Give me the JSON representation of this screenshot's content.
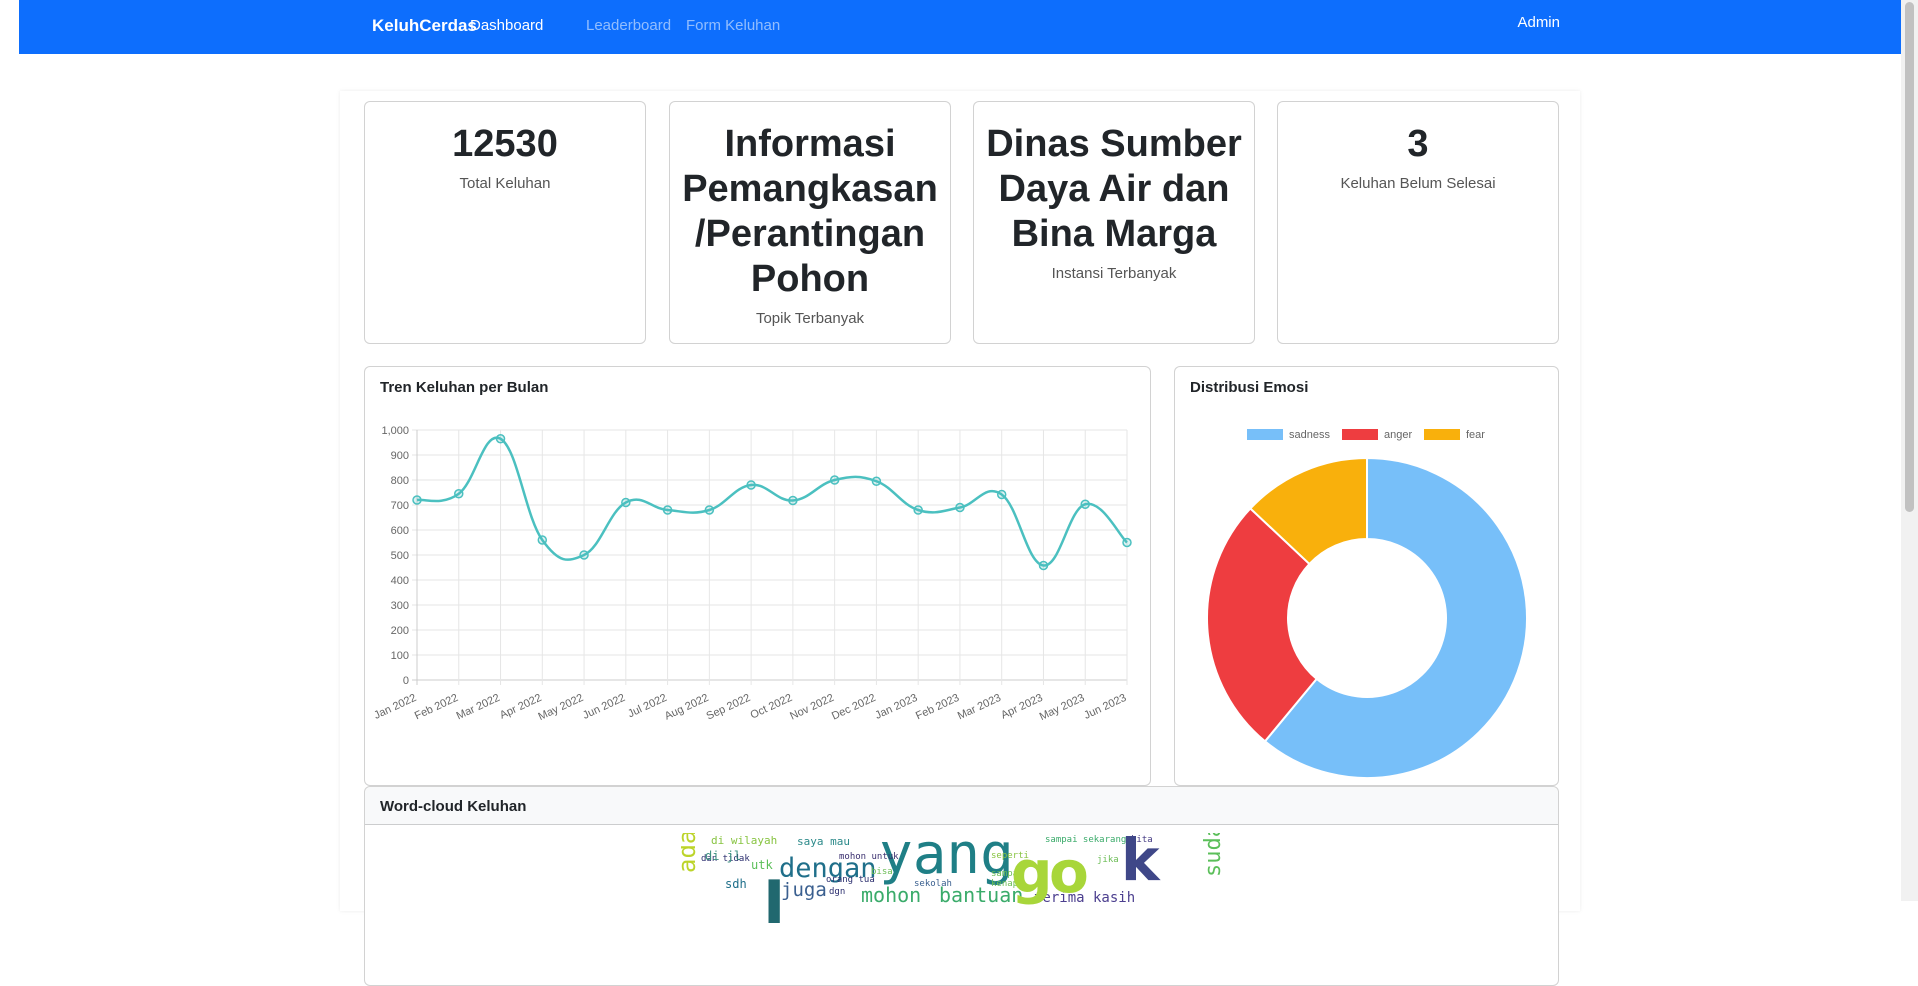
{
  "navbar": {
    "brand": "KeluhCerdas",
    "links": [
      "Dashboard",
      "Leaderboard",
      "Form Keluhan"
    ],
    "active_link": "Dashboard",
    "user": "Admin",
    "color": "#0d6efd"
  },
  "stats": [
    {
      "value": "12530",
      "label": "Total Keluhan"
    },
    {
      "value": "Informasi Pemangkasan /Perantingan Pohon",
      "label": "Topik Terbanyak"
    },
    {
      "value": "Dinas Sumber Daya Air dan Bina Marga",
      "label": "Instansi Terbanyak"
    },
    {
      "value": "3",
      "label": "Keluhan Belum Selesai"
    }
  ],
  "trend_card": {
    "title": "Tren Keluhan per Bulan"
  },
  "emotion_card": {
    "title": "Distribusi Emosi"
  },
  "wordcloud_card": {
    "title": "Word-cloud Keluhan",
    "words": [
      "yang",
      "dengan",
      "mohon",
      "bantuan",
      "juga",
      "ada",
      "sudah",
      "di wilayah",
      "saya mau",
      "sampai sekarang",
      "terima kasih",
      "dan tidak",
      "di jl",
      "sdh",
      "utk",
      "seperti",
      "sampai",
      "jika",
      "kita",
      "kenapa",
      "sekolah",
      "orang tua",
      "mohon untuk",
      "dgn",
      "bisa"
    ]
  },
  "chart_data": [
    {
      "type": "line",
      "title": "",
      "categories": [
        "Jan 2022",
        "Feb 2022",
        "Mar 2022",
        "Apr 2022",
        "May 2022",
        "Jun 2022",
        "Jul 2022",
        "Aug 2022",
        "Sep 2022",
        "Oct 2022",
        "Nov 2022",
        "Dec 2022",
        "Jan 2023",
        "Feb 2023",
        "Mar 2023",
        "Apr 2023",
        "May 2023",
        "Jun 2023"
      ],
      "values": [
        720,
        745,
        965,
        560,
        500,
        710,
        680,
        680,
        780,
        718,
        800,
        795,
        680,
        690,
        742,
        458,
        703,
        550
      ],
      "ylim": [
        0,
        1000
      ],
      "yticks": [
        "0",
        "100",
        "200",
        "300",
        "400",
        "500",
        "600",
        "700",
        "800",
        "900",
        "1,000"
      ],
      "grid": true,
      "color": "#4bc0c0"
    },
    {
      "type": "pie",
      "donut": true,
      "legend_position": "top",
      "labels": [
        "sadness",
        "anger",
        "fear"
      ],
      "values": [
        61,
        26,
        13
      ],
      "colors": [
        "#77bff9",
        "#ee3d40",
        "#f9b00c"
      ]
    }
  ]
}
